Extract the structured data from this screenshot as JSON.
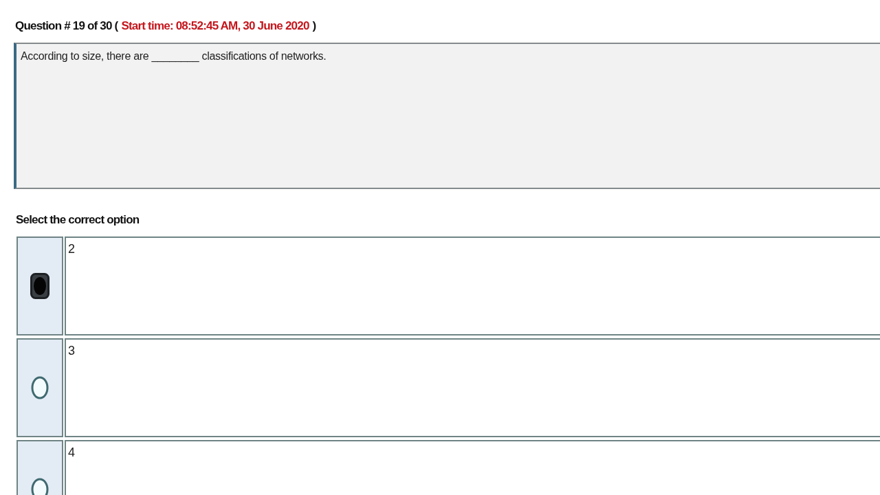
{
  "header": {
    "question_number": "Question # 19 of 30 (",
    "start_time": "Start time: 08:52:45 AM, 30 June 2020",
    "closing": ")"
  },
  "question": {
    "text": "According to size, there are ________ classifications of networks."
  },
  "prompt": "Select the correct option",
  "options": [
    {
      "label": "2",
      "selected": true
    },
    {
      "label": "3",
      "selected": false
    },
    {
      "label": "4",
      "selected": false
    }
  ]
}
